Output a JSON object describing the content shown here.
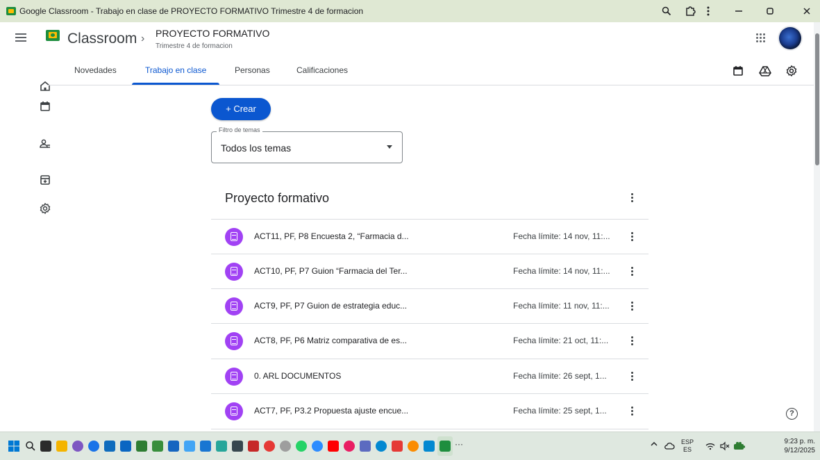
{
  "window": {
    "title": "Google Classroom - Trabajo en clase de PROYECTO FORMATIVO Trimestre 4 de formacion",
    "controls": [
      "zoom-icon",
      "extension-icon",
      "more-icon",
      "minimize-icon",
      "restore-icon",
      "close-icon"
    ]
  },
  "header": {
    "brand": "Classroom",
    "breadcrumb_sep": "›",
    "course_title": "PROYECTO FORMATIVO",
    "course_subtitle": "Trimestre 4 de formacion"
  },
  "rail": [
    "home-icon",
    "calendar-icon",
    "people-icon",
    "archive-icon",
    "settings-icon"
  ],
  "tabs": [
    {
      "label": "Novedades",
      "active": false
    },
    {
      "label": "Trabajo en clase",
      "active": true
    },
    {
      "label": "Personas",
      "active": false
    },
    {
      "label": "Calificaciones",
      "active": false
    }
  ],
  "tab_actions": [
    "calendar-icon",
    "drive-icon",
    "settings-icon"
  ],
  "create_button": "+  Crear",
  "filter": {
    "legend": "Filtro de temas",
    "value": "Todos los temas"
  },
  "topic": {
    "title": "Proyecto formativo",
    "items": [
      {
        "title": "ACT11, PF, P8 Encuesta 2, “Farmacia d...",
        "due": "Fecha límite: 14 nov, 11:..."
      },
      {
        "title": "ACT10, PF, P7 Guion “Farmacia del Ter...",
        "due": "Fecha límite: 14 nov, 11:..."
      },
      {
        "title": "ACT9, PF, P7 Guion de estrategia educ...",
        "due": "Fecha límite: 11 nov, 11:..."
      },
      {
        "title": "ACT8, PF, P6 Matriz comparativa de es...",
        "due": "Fecha límite: 21 oct, 11:..."
      },
      {
        "title": "0. ARL DOCUMENTOS",
        "due": "Fecha límite: 26 sept, 1..."
      },
      {
        "title": "ACT7, PF, P3.2 Propuesta ajuste encue...",
        "due": "Fecha límite: 25 sept, 1..."
      }
    ]
  },
  "help": "?",
  "taskbar": {
    "lang_top": "ESP",
    "lang_bottom": "ES",
    "time": "9:23 p. m.",
    "date": "9/12/2025",
    "overflow": "···",
    "colors": {
      "accent": "#0b57d0",
      "assignment": "#a142f4",
      "classroom_green": "#1e8e3e"
    }
  }
}
